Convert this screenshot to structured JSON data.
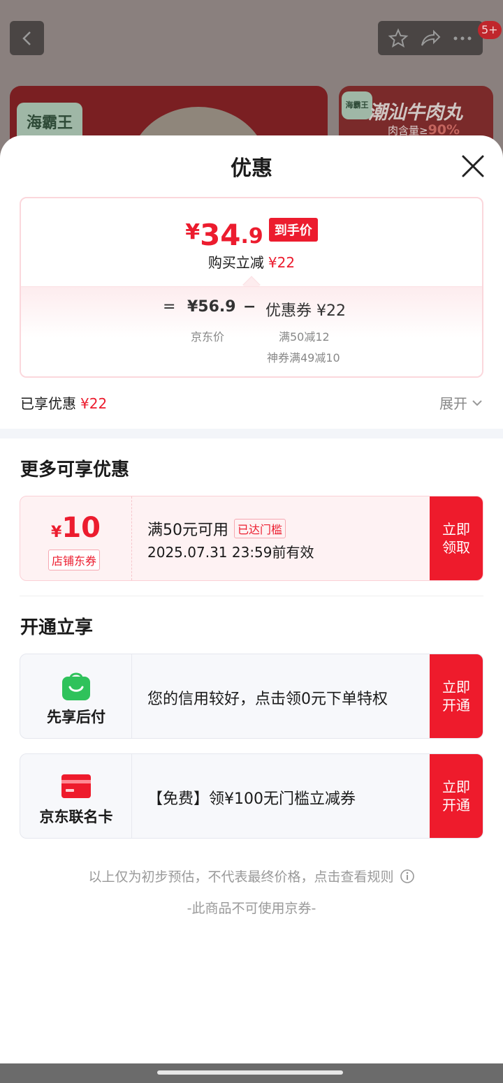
{
  "background": {
    "badge": "5+",
    "brand": "海霸王",
    "card2_title": "潮汕牛肉丸",
    "card2_sub_prefix": "肉含量≥",
    "card2_sub_value": "90%"
  },
  "sheet": {
    "title": "优惠"
  },
  "price": {
    "yen": "¥",
    "integer": "34",
    "decimal": ".9",
    "final_tag": "到手价",
    "instant_label": "购买立减",
    "instant_value": "¥22"
  },
  "formula": {
    "eq": "=",
    "base": "¥56.9",
    "minus": "−",
    "coupon_label": "优惠券 ¥22",
    "base_caption": "京东价",
    "coupon_detail_1": "满50减12",
    "coupon_detail_2": "神券满49减10"
  },
  "summary": {
    "label": "已享优惠",
    "value": "¥22",
    "expand": "展开"
  },
  "more": {
    "title": "更多可享优惠",
    "coupon": {
      "yen": "¥",
      "amount": "10",
      "type": "店铺东券",
      "condition": "满50元可用",
      "reach_tag": "已达门槛",
      "validity": "2025.07.31 23:59前有效",
      "button": "立即\n领取"
    }
  },
  "open": {
    "title": "开通立享",
    "items": [
      {
        "icon": "shopping-bag-icon",
        "label": "先享后付",
        "text": "您的信用较好，点击领0元下单特权",
        "button": "立即\n开通",
        "color": "#2fc25b"
      },
      {
        "icon": "credit-card-icon",
        "label": "京东联名卡",
        "text": "【免费】领¥100无门槛立减券",
        "button": "立即\n开通",
        "color": "#ee1b2c"
      }
    ]
  },
  "notes": {
    "estimate": "以上仅为初步预估，不代表最终价格，点击查看规则",
    "no_jd_coupon": "-此商品不可使用京券-"
  },
  "colors": {
    "accent": "#ec1c2e",
    "green": "#2fc25b"
  }
}
